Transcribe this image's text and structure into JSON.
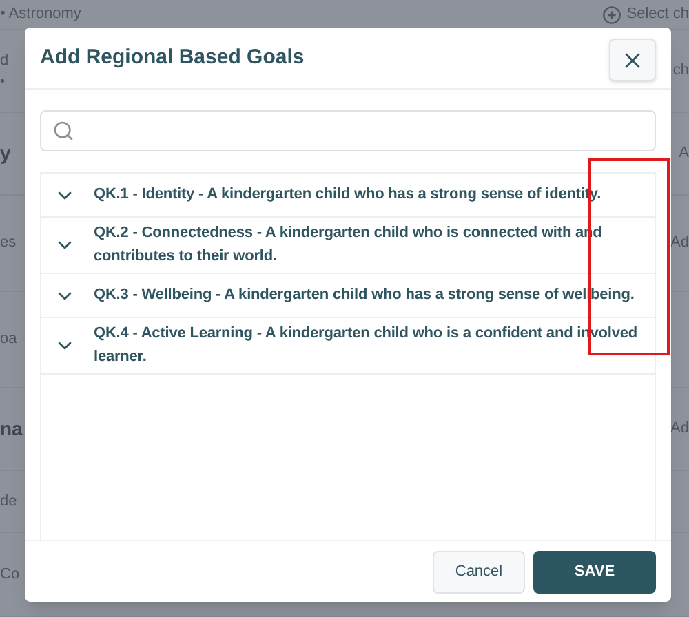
{
  "background": {
    "rows": [
      {
        "left": "• Astronomy",
        "right": "Select ch",
        "right_icon": true,
        "heading": false
      },
      {
        "left": "d",
        "left_sub": "•",
        "right": "ch",
        "heading": false
      },
      {
        "left": "y",
        "right": "A",
        "heading": true
      },
      {
        "left": "es",
        "right": "Ad",
        "heading": false
      },
      {
        "left": "oa",
        "heading": false
      },
      {
        "left": "na",
        "right": "Ad",
        "heading": true
      },
      {
        "left": "de",
        "heading": false
      },
      {
        "left": "Co",
        "heading": false
      }
    ]
  },
  "dialog": {
    "title": "Add Regional Based Goals",
    "goals": [
      {
        "label": "QK.1 - Identity - A kindergarten child who has a strong sense of identity.",
        "expanded": false
      },
      {
        "label": "QK.2 - Connectedness - A kindergarten child who is connected with and contributes to their world.",
        "expanded": false
      },
      {
        "label": "QK.3 - Wellbeing - A kindergarten child who has a strong sense of wellbeing.",
        "expanded": false
      },
      {
        "label": "QK.4 - Active Learning - A kindergarten child who is a confident and involved learner.",
        "expanded": false
      }
    ],
    "buttons": [
      {
        "label": "Cancel",
        "kind": "secondary"
      },
      {
        "label": "SAVE",
        "kind": "primary"
      }
    ]
  }
}
